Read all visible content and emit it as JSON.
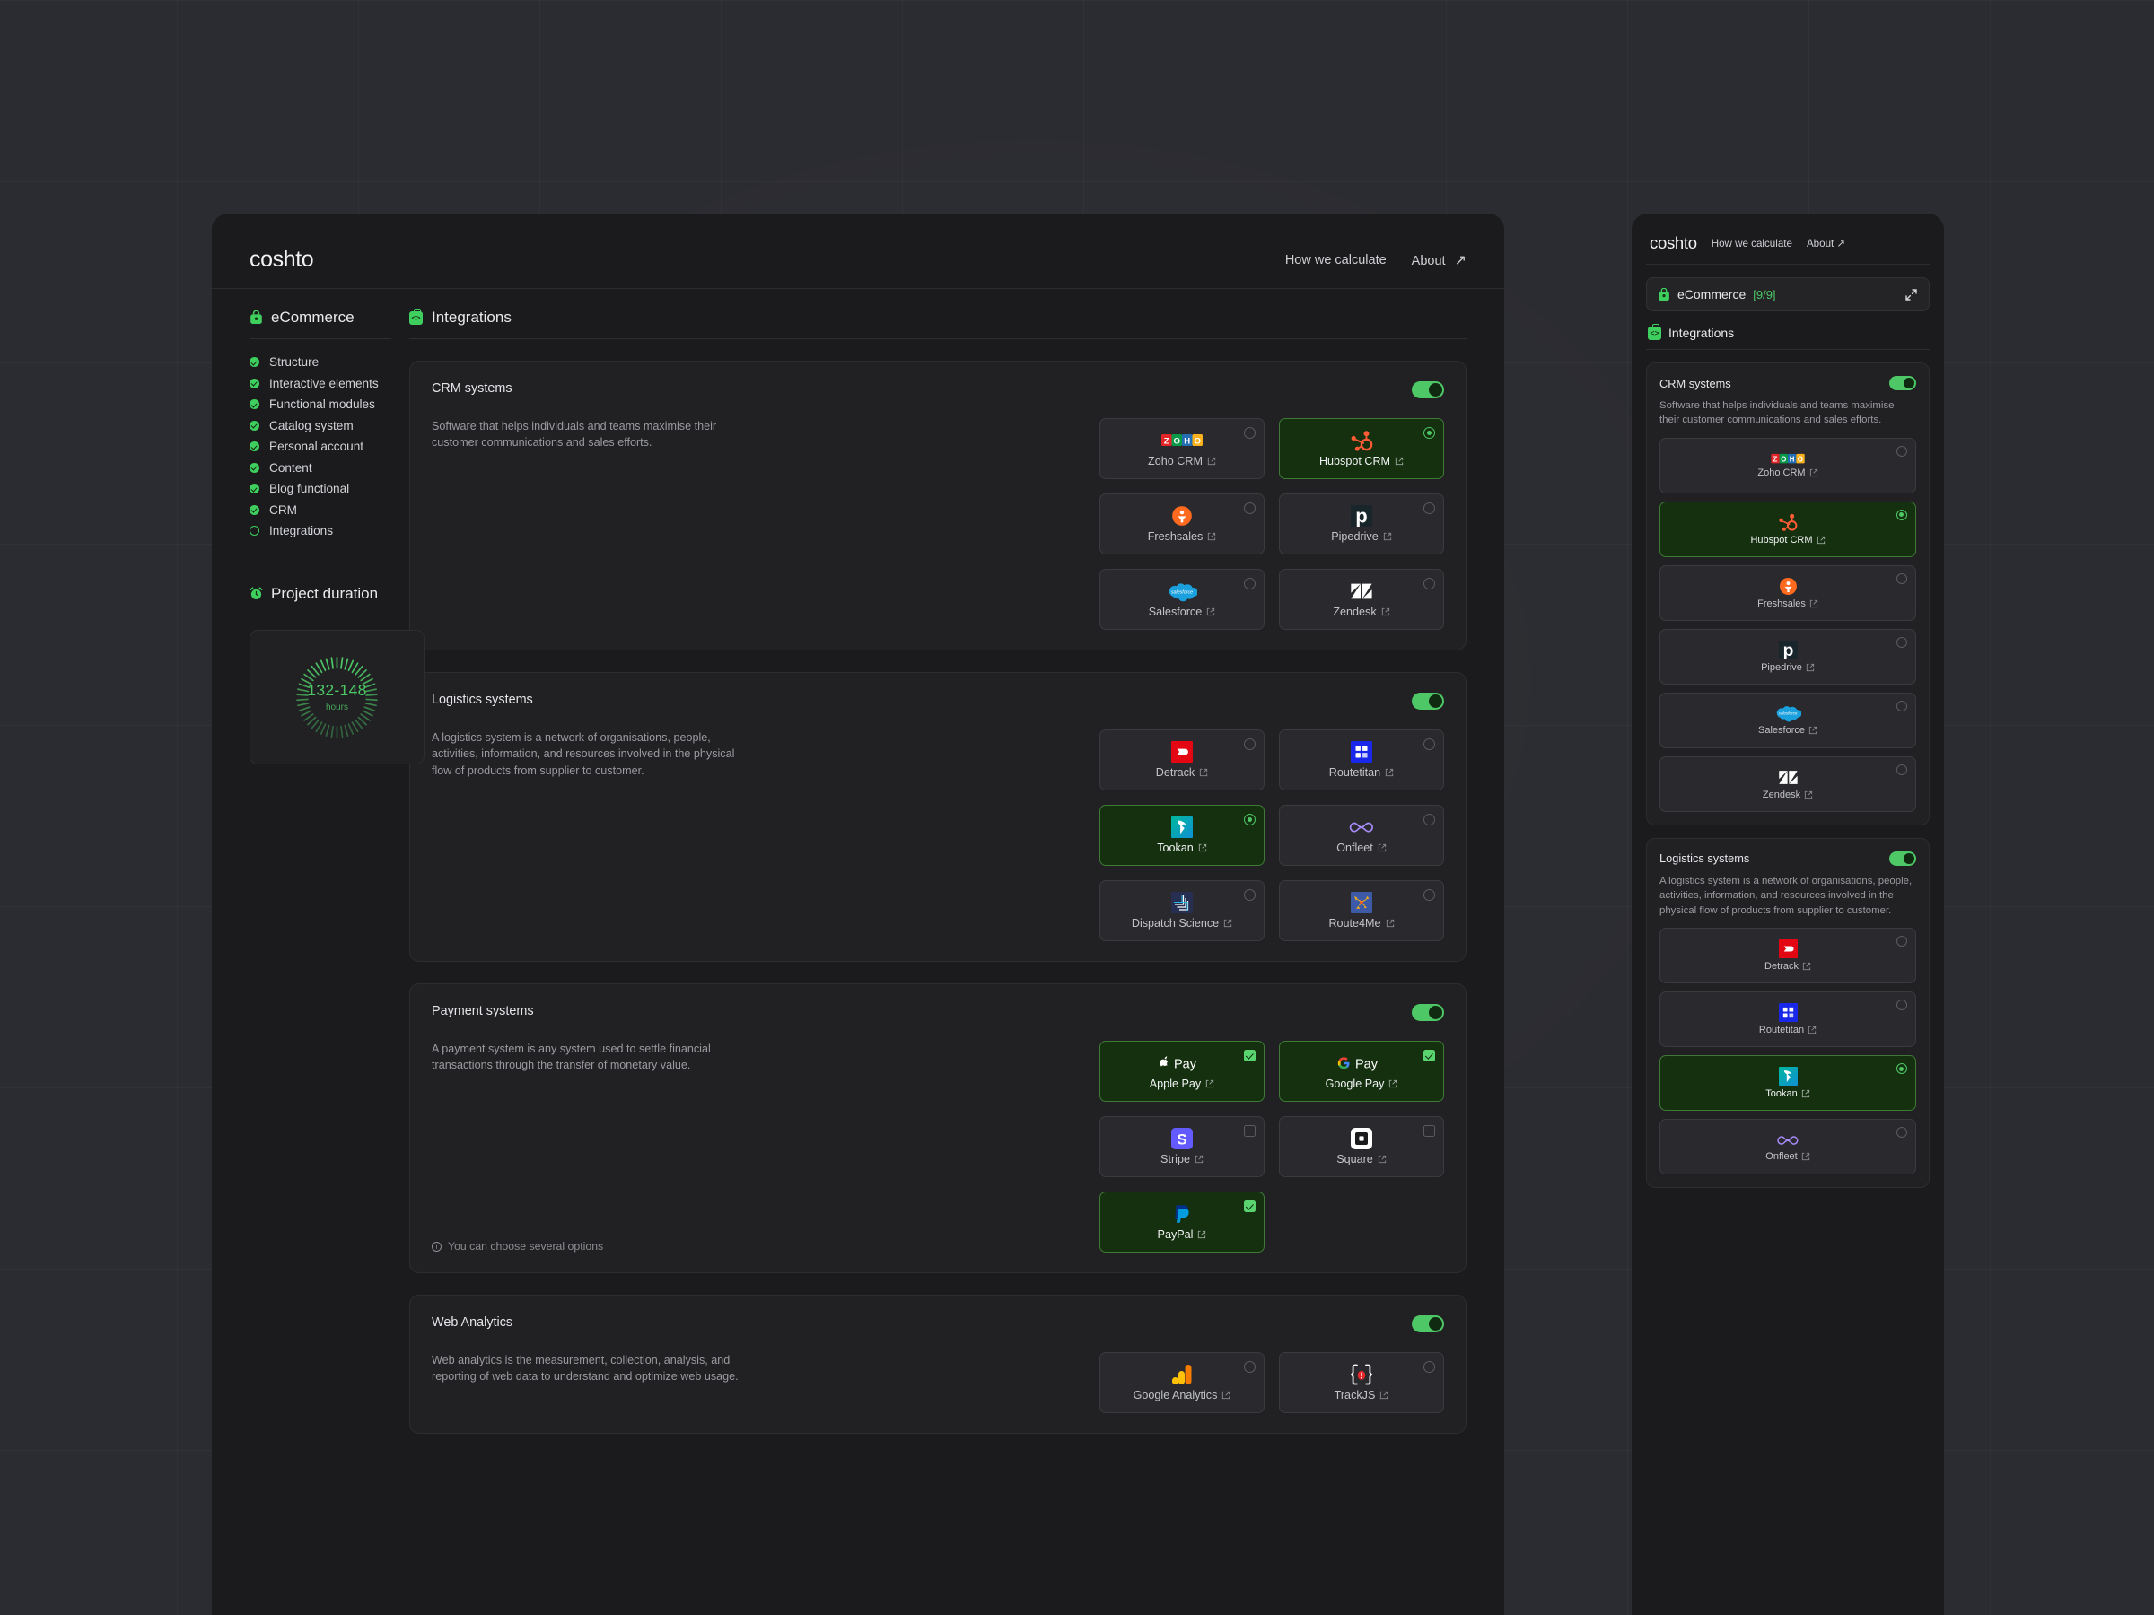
{
  "app": {
    "logo": "coshto",
    "nav": [
      {
        "label": "How we calculate"
      },
      {
        "label": "About",
        "icon": "arrow-up-right-icon"
      }
    ]
  },
  "sidebar": {
    "section_title": "eCommerce",
    "section_icon": "bag-icon",
    "items": [
      {
        "label": "Structure",
        "state": "done"
      },
      {
        "label": "Interactive elements",
        "state": "done"
      },
      {
        "label": "Functional modules",
        "state": "done"
      },
      {
        "label": "Catalog system",
        "state": "done"
      },
      {
        "label": "Personal account",
        "state": "done"
      },
      {
        "label": "Content",
        "state": "done"
      },
      {
        "label": "Blog functional",
        "state": "done"
      },
      {
        "label": "CRM",
        "state": "done"
      },
      {
        "label": "Integrations",
        "state": "current"
      }
    ],
    "duration": {
      "title": "Project duration",
      "icon": "alarm-clock-icon",
      "value": "132-148",
      "unit": "hours"
    }
  },
  "content": {
    "title": "Integrations",
    "title_icon": "code-bag-icon",
    "sections": [
      {
        "title": "CRM systems",
        "enabled": true,
        "description": "Software that helps individuals and teams maximise their customer communications and sales efforts.",
        "select_mode": "radio",
        "hint": null,
        "options": [
          {
            "label": "Zoho CRM",
            "logo": "zoho-logo",
            "selected": false
          },
          {
            "label": "Hubspot CRM",
            "logo": "hubspot-logo",
            "selected": true
          },
          {
            "label": "Freshsales",
            "logo": "freshsales-logo",
            "selected": false
          },
          {
            "label": "Pipedrive",
            "logo": "pipedrive-logo",
            "selected": false
          },
          {
            "label": "Salesforce",
            "logo": "salesforce-logo",
            "selected": false
          },
          {
            "label": "Zendesk",
            "logo": "zendesk-logo",
            "selected": false
          }
        ]
      },
      {
        "title": "Logistics systems",
        "enabled": true,
        "description": "A logistics system is a network of organisations, people, activities, information, and resources involved in the physical flow of products from supplier to customer.",
        "select_mode": "radio",
        "hint": null,
        "options": [
          {
            "label": "Detrack",
            "logo": "detrack-logo",
            "selected": false
          },
          {
            "label": "Routetitan",
            "logo": "routetitan-logo",
            "selected": false
          },
          {
            "label": "Tookan",
            "logo": "tookan-logo",
            "selected": true
          },
          {
            "label": "Onfleet",
            "logo": "onfleet-logo",
            "selected": false
          },
          {
            "label": "Dispatch Science",
            "logo": "dispatchscience-logo",
            "selected": false
          },
          {
            "label": "Route4Me",
            "logo": "route4me-logo",
            "selected": false
          }
        ]
      },
      {
        "title": "Payment systems",
        "enabled": true,
        "description": "A payment system is any system used to settle financial transactions through the transfer of monetary value.",
        "select_mode": "checkbox",
        "hint": "You can choose several options",
        "options": [
          {
            "label": "Apple Pay",
            "logo": "apple-pay-logo",
            "selected": true
          },
          {
            "label": "Google Pay",
            "logo": "google-pay-logo",
            "selected": true
          },
          {
            "label": "Stripe",
            "logo": "stripe-logo",
            "selected": false
          },
          {
            "label": "Square",
            "logo": "square-logo",
            "selected": false
          },
          {
            "label": "PayPal",
            "logo": "paypal-logo",
            "selected": true
          }
        ]
      },
      {
        "title": "Web Analytics",
        "enabled": true,
        "description": "Web analytics is the measurement, collection, analysis, and reporting of web data to understand and optimize web usage.",
        "select_mode": "radio",
        "hint": null,
        "options": [
          {
            "label": "Google Analytics",
            "logo": "google-analytics-logo",
            "selected": false
          },
          {
            "label": "TrackJS",
            "logo": "trackjs-logo",
            "selected": false
          }
        ]
      }
    ]
  },
  "right_panel": {
    "logo": "coshto",
    "nav": [
      {
        "label": "How we calculate"
      },
      {
        "label": "About",
        "icon": "arrow-up-right-icon"
      }
    ],
    "chip": {
      "label": "eCommerce",
      "count": "[9/9]",
      "icon": "bag-icon",
      "expand_icon": "expand-icon"
    },
    "section_title": "Integrations",
    "section_icon": "code-bag-icon",
    "cards": [
      {
        "title": "CRM systems",
        "enabled": true,
        "description": "Software that helps individuals and teams maximise their customer communications and sales efforts.",
        "options": [
          {
            "label": "Zoho CRM",
            "logo": "zoho-logo",
            "selected": false
          },
          {
            "label": "Hubspot CRM",
            "logo": "hubspot-logo",
            "selected": true
          },
          {
            "label": "Freshsales",
            "logo": "freshsales-logo",
            "selected": false
          },
          {
            "label": "Pipedrive",
            "logo": "pipedrive-logo",
            "selected": false
          },
          {
            "label": "Salesforce",
            "logo": "salesforce-logo",
            "selected": false
          },
          {
            "label": "Zendesk",
            "logo": "zendesk-logo",
            "selected": false
          }
        ]
      },
      {
        "title": "Logistics systems",
        "enabled": true,
        "description": "A logistics system is a network of organisations, people, activities, information, and resources involved in the physical flow of products from supplier to customer.",
        "options": [
          {
            "label": "Detrack",
            "logo": "detrack-logo",
            "selected": false
          },
          {
            "label": "Routetitan",
            "logo": "routetitan-logo",
            "selected": false
          },
          {
            "label": "Tookan",
            "logo": "tookan-logo",
            "selected": true
          },
          {
            "label": "Onfleet",
            "logo": "onfleet-logo",
            "selected": false
          }
        ]
      }
    ]
  },
  "colors": {
    "accent_green": "#4ec766",
    "panel_bg": "#1b1b1d",
    "card_bg": "#212124",
    "tile_bg": "#2a2a2e",
    "tile_selected_bg": "#14300f",
    "page_bg": "#2b2c31"
  }
}
